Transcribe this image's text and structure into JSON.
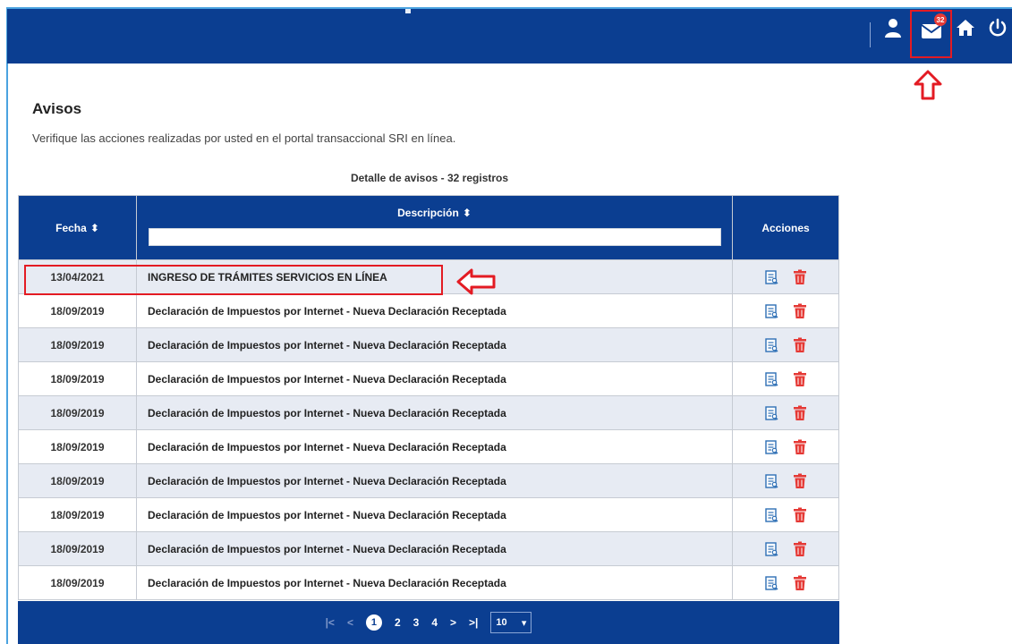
{
  "topbar": {
    "icons": [
      "user-icon",
      "mail-icon",
      "home-icon",
      "power-icon"
    ],
    "mail_badge": "32",
    "color": "#0b3e91"
  },
  "page": {
    "title": "Avisos",
    "subtitle": "Verifique las acciones realizadas por usted en el portal transaccional SRI en línea."
  },
  "table": {
    "caption": "Detalle de avisos - 32 registros",
    "headers": {
      "fecha": "Fecha",
      "descripcion": "Descripción",
      "acciones": "Acciones"
    },
    "sort_icon": "⬍",
    "filter_value": "",
    "rows": [
      {
        "fecha": "13/04/2021",
        "descripcion": "INGRESO DE TRÁMITES SERVICIOS EN LÍNEA"
      },
      {
        "fecha": "18/09/2019",
        "descripcion": "Declaración de Impuestos por Internet - Nueva Declaración Receptada"
      },
      {
        "fecha": "18/09/2019",
        "descripcion": "Declaración de Impuestos por Internet - Nueva Declaración Receptada"
      },
      {
        "fecha": "18/09/2019",
        "descripcion": "Declaración de Impuestos por Internet - Nueva Declaración Receptada"
      },
      {
        "fecha": "18/09/2019",
        "descripcion": "Declaración de Impuestos por Internet - Nueva Declaración Receptada"
      },
      {
        "fecha": "18/09/2019",
        "descripcion": "Declaración de Impuestos por Internet - Nueva Declaración Receptada"
      },
      {
        "fecha": "18/09/2019",
        "descripcion": "Declaración de Impuestos por Internet - Nueva Declaración Receptada"
      },
      {
        "fecha": "18/09/2019",
        "descripcion": "Declaración de Impuestos por Internet - Nueva Declaración Receptada"
      },
      {
        "fecha": "18/09/2019",
        "descripcion": "Declaración de Impuestos por Internet - Nueva Declaración Receptada"
      },
      {
        "fecha": "18/09/2019",
        "descripcion": "Declaración de Impuestos por Internet - Nueva Declaración Receptada"
      }
    ],
    "row_actions": [
      "view-detail-icon",
      "trash-icon"
    ]
  },
  "pagination": {
    "first": "|<",
    "prev": "<",
    "pages": [
      "1",
      "2",
      "3",
      "4"
    ],
    "current": "1",
    "next": ">",
    "last": ">|",
    "page_size": "10"
  },
  "colors": {
    "brand": "#0b3e91",
    "annotation": "#e31b23",
    "delete": "#e53935",
    "view": "#2e6fb5"
  }
}
